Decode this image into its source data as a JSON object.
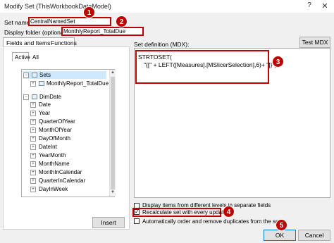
{
  "window": {
    "title": "Modify Set (ThisWorkbookDataModel)",
    "help": "?",
    "close": "✕"
  },
  "form": {
    "set_name_label": "Set name:",
    "set_name_value": "CentralNamedSet",
    "folder_label": "Display folder (optional):",
    "folder_value": "MonthlyReport_TotalDue"
  },
  "tabs": {
    "fields_items": "Fields and Items",
    "functions": "Functions"
  },
  "subtabs": {
    "active": "Active",
    "all": "All"
  },
  "tree": {
    "sets": "Sets",
    "sets_child": "MonthlyReport_TotalDue",
    "dimdate": "DimDate",
    "fields": [
      "Date",
      "Year",
      "QuarterOfYear",
      "MonthOfYear",
      "DayOfMonth",
      "DateInt",
      "YearMonth",
      "MonthName",
      "MonthInCalendar",
      "QuarterInCalendar",
      "DayInWeek"
    ]
  },
  "buttons": {
    "test_mdx": "Test MDX",
    "insert": "Insert",
    "ok": "OK",
    "cancel": "Cancel"
  },
  "definition": {
    "label": "Set definition (MDX):",
    "line1": "STRTOSET(",
    "line2": "\"{[\" + LEFT([Measures].[MSlicerSelection],6)+ \"]}\")"
  },
  "options": {
    "display_items": "Display items from different levels in separate fields",
    "recalculate": "Recalculate set with every update",
    "auto_order": "Automatically order and remove duplicates from the set"
  },
  "badges": [
    "1",
    "2",
    "3",
    "4",
    "5"
  ],
  "colors": {
    "accent_red": "#c00000",
    "selection_blue": "#0078d7"
  }
}
